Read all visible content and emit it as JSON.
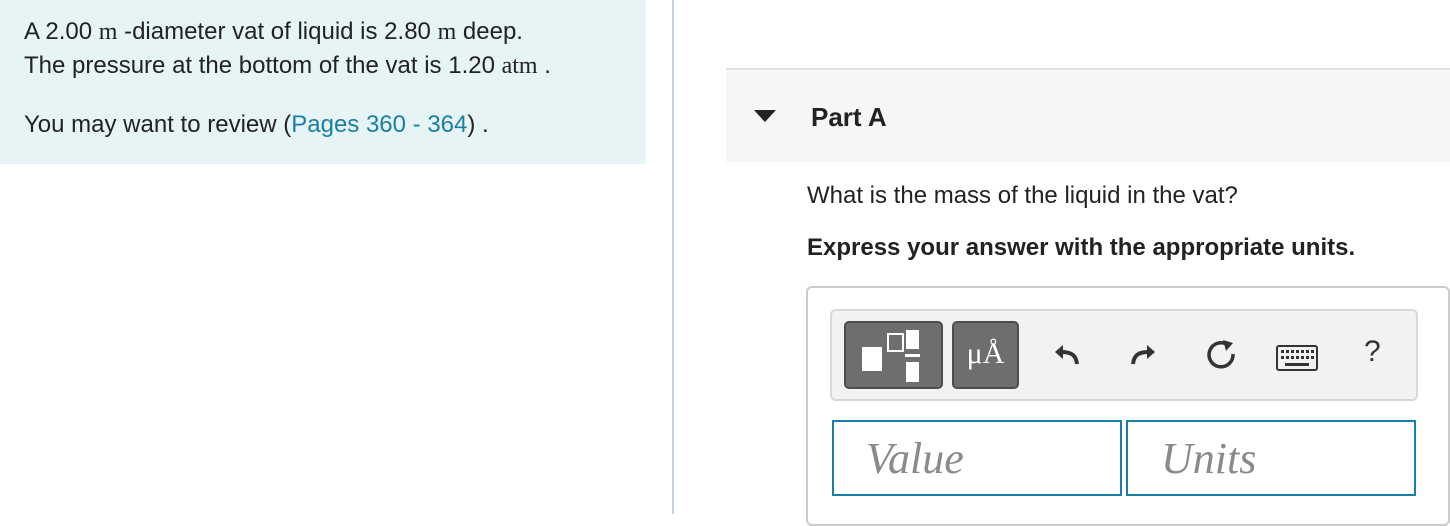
{
  "problem": {
    "line1_pre": "A 2.00 ",
    "unit_m1": "m",
    "line1_mid": " -diameter vat of liquid is 2.80 ",
    "unit_m2": "m",
    "line1_post": " deep.",
    "line2_pre": "The pressure at the bottom of the vat is 1.20 ",
    "unit_atm": "atm",
    "line2_post": " .",
    "review_pre": "You may want to review (",
    "review_link": "Pages 360 - 364",
    "review_post": ") ."
  },
  "part": {
    "title": "Part A",
    "question": "What is the mass of the liquid in the vat?",
    "instruction": "Express your answer with the appropriate units."
  },
  "toolbar": {
    "units_label": "μÅ",
    "help_label": "?",
    "icons": [
      "templates-icon",
      "units-icon",
      "undo-icon",
      "redo-icon",
      "reset-icon",
      "keyboard-icon",
      "help-icon"
    ]
  },
  "answer": {
    "value_placeholder": "Value",
    "units_placeholder": "Units",
    "value": "",
    "units": ""
  },
  "colors": {
    "problem_bg": "#e6f4f5",
    "link": "#1b7ea5",
    "field_border": "#1b7ea5",
    "toolbar_button": "#6e6e6e"
  }
}
